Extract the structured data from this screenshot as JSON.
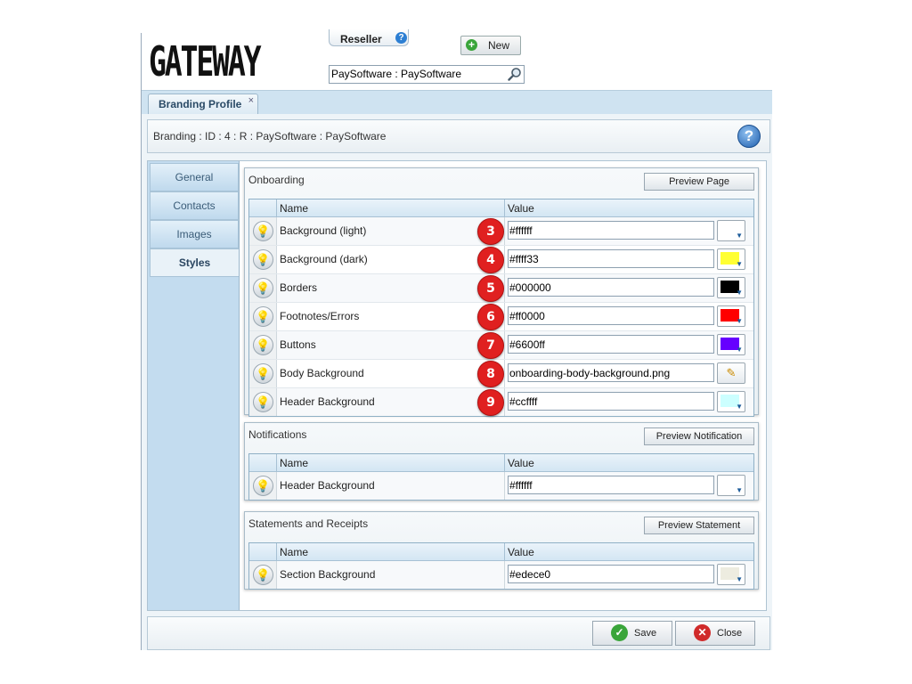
{
  "header": {
    "logo_text": "GATEWAY",
    "reseller_label": "Reseller",
    "help_glyph": "?",
    "new_label": "New",
    "search_value": "PaySoftware : PaySoftware"
  },
  "tabs": [
    {
      "label": "Branding Profile",
      "close": "×"
    }
  ],
  "info": {
    "text": "Branding : ID : 4 : R : PaySoftware : PaySoftware",
    "help_glyph": "?"
  },
  "side_tabs": [
    "General",
    "Contacts",
    "Images",
    "Styles"
  ],
  "active_side_tab": "Styles",
  "columns": {
    "name": "Name",
    "value": "Value"
  },
  "sections": {
    "onboarding": {
      "title": "Onboarding",
      "button": "Preview Page",
      "rows": [
        {
          "name": "Background (light)",
          "value": "#ffffff",
          "badge": "3",
          "swatch": "#ffffff"
        },
        {
          "name": "Background (dark)",
          "value": "#ffff33",
          "badge": "4",
          "swatch": "#ffff33"
        },
        {
          "name": "Borders",
          "value": "#000000",
          "badge": "5",
          "swatch": "#000000"
        },
        {
          "name": "Footnotes/Errors",
          "value": "#ff0000",
          "badge": "6",
          "swatch": "#ff0000"
        },
        {
          "name": "Buttons",
          "value": "#6600ff",
          "badge": "7",
          "swatch": "#6600ff"
        },
        {
          "name": "Body Background",
          "value": "onboarding-body-background.png",
          "badge": "8",
          "swatch": ""
        },
        {
          "name": "Header Background",
          "value": "#ccffff",
          "badge": "9",
          "swatch": "#ccffff"
        }
      ]
    },
    "notifications": {
      "title": "Notifications",
      "button": "Preview Notification",
      "rows": [
        {
          "name": "Header Background",
          "value": "#ffffff",
          "swatch": "#ffffff"
        }
      ]
    },
    "statements": {
      "title": "Statements and Receipts",
      "button": "Preview Statement",
      "rows": [
        {
          "name": "Section Background",
          "value": "#edece0",
          "swatch": "#edece0"
        }
      ]
    }
  },
  "footer": {
    "save": "Save",
    "close": "Close"
  },
  "icons": {
    "bulb": "lightbulb-icon",
    "search": "magnifier-icon",
    "edit": "pencil-icon",
    "save": "check-icon",
    "close": "x-icon"
  }
}
